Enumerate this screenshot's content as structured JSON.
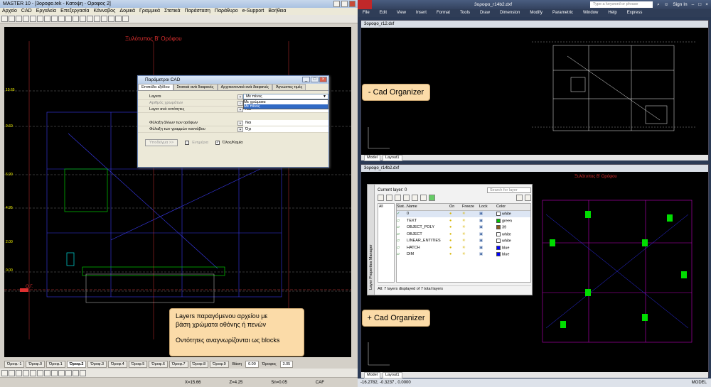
{
  "left_app": {
    "title": "MASTER 10 - [3οροφο.tek - Κατοψη - Οροφος 2]",
    "menu": [
      "Αρχείο",
      "CAD",
      "Εργαλεία",
      "Επεξεργασία",
      "Κάνναβος",
      "Δομικά",
      "Γραμμικά",
      "Στατικά",
      "Παράσταση",
      "Παράθυρο",
      "e-Support",
      "Βοήθεια"
    ],
    "drawing_title": "Ξυλότυπος Β' Ορόφου",
    "level_labels": [
      "10.65",
      "9.60",
      "6.90",
      "4.95",
      "2.00",
      "0.00",
      "Ο.Γ."
    ],
    "floor_tabs": [
      "Όροφ.-1",
      "Όροφ.0",
      "Όροφ.1",
      "Όροφ.2",
      "Όροφ.3",
      "Όροφ.4",
      "Όροφ.5",
      "Όροφ.6",
      "Όροφ.7",
      "Όροφ.8",
      "Όροφ.9"
    ],
    "active_floor_index": 3,
    "vasi_label": "Βάση",
    "vasi_value": "0.00",
    "orofos_label": "Όροφος",
    "orofos_value": "3.05",
    "status": {
      "x": "X=15.66",
      "z": "Z=4.25",
      "sn": "Sn=0.05",
      "caf": "CAF"
    }
  },
  "dialog": {
    "title": "Παράμετροι CAD",
    "tabs": [
      "Επιπέδα εξόδου",
      "Στατικά ανά διαφανές",
      "Αρχιτεκτονικά ανά διαφανές",
      "Άγνωστες τιμές"
    ],
    "rows": [
      {
        "label": "Layers",
        "value": "Με πένες"
      },
      {
        "label": "Αριθμός χρωμάτων",
        "value": ""
      },
      {
        "label": "Layer ανά οντότητες",
        "value": "Ναι"
      },
      {
        "label": "Φύλαξη άλλων των ορόφων",
        "value": "Ναι"
      },
      {
        "label": "Φύλαξη των γραμμών καννάβου",
        "value": "Όχι"
      }
    ],
    "dropdown_options": [
      "Με χρώματα",
      "Με πένες"
    ],
    "button_update": "Υποδείγμα >>",
    "check_enable": "Ενημέρια",
    "check_all": "Όλος/Καμία"
  },
  "callouts": {
    "left_box_line1": "Layers παραγόμενου αρχείου με",
    "left_box_line2": "βάση χρώματα οθόνης ή πενών",
    "left_box_line3": "Οντότητες αναγνωρίζονται ως blocks",
    "minus_cad": "- Cad Organizer",
    "plus_cad": "+ Cad Organizer"
  },
  "right_app": {
    "title": "3οροφο_r14b2.dxf",
    "search_placeholder": "Type a keyword or phrase",
    "sign_in": "Sign In",
    "menu": [
      "File",
      "Edit",
      "View",
      "Insert",
      "Format",
      "Tools",
      "Draw",
      "Dimension",
      "Modify",
      "Parametric",
      "Window",
      "Help",
      "Express"
    ],
    "viewport1_title": "3οροφο_r12.dxf",
    "viewport2_title": "3οροφο_r14b2.dxf",
    "viewport2_drawing_title": "Ξυλότυπος Β' Ορόφου",
    "layout_tabs": [
      "Model",
      "Layout1"
    ],
    "status_coords": "-16.2782, -0.3237 , 0.0000",
    "status_model": "MODEL"
  },
  "layer_manager": {
    "side_title": "Layer Properties Manager",
    "current_layer": "Current layer: 0",
    "search_placeholder": "Search for layer",
    "all_label": "All",
    "used_label": "All Used Layers",
    "columns": [
      "Stat...",
      "Name",
      "On",
      "Freeze",
      "Lock",
      "Color"
    ],
    "layers": [
      {
        "name": "0",
        "color_name": "white",
        "color": "#ffffff"
      },
      {
        "name": "TEXT",
        "color_name": "green",
        "color": "#00c000"
      },
      {
        "name": "OBJECT_POLY",
        "color_name": "39",
        "color": "#8a5a20"
      },
      {
        "name": "OBJECT",
        "color_name": "white",
        "color": "#ffffff"
      },
      {
        "name": "LINEAR_ENTITIES",
        "color_name": "white",
        "color": "#ffffff"
      },
      {
        "name": "HATCH",
        "color_name": "blue",
        "color": "#0000ff"
      },
      {
        "name": "DIM",
        "color_name": "blue",
        "color": "#0000ff"
      }
    ],
    "footer": "All: 7 layers displayed of 7 total layers"
  }
}
